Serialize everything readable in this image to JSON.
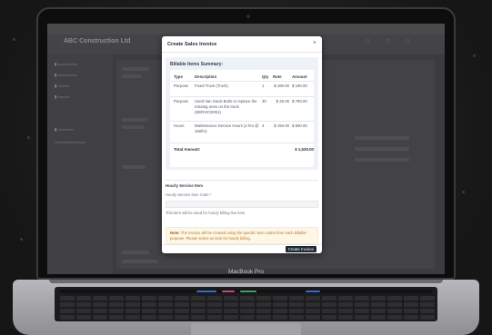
{
  "device": {
    "brand_label": "MacBook Pro"
  },
  "background_app": {
    "company_name": "ABC Construction Ltd"
  },
  "modal": {
    "title": "Create Sales Invoice",
    "close_icon": "close-icon",
    "summary": {
      "title": "Billable Items Summary:",
      "columns": [
        "Type",
        "Description",
        "Qty",
        "Rate",
        "Amount"
      ],
      "rows": [
        {
          "type": "Purpose",
          "description": "Fixed Truck (Truck)",
          "qty": "1",
          "rate": "$ 180.00",
          "amount": "$ 180.00"
        },
        {
          "type": "Purpose",
          "description": "Used Van Stock Bolts to replace the missing ones on the truck (SERVICE001)",
          "qty": "30",
          "rate": "$ 25.00",
          "amount": "$ 750.00"
        },
        {
          "type": "Hours",
          "description": "Maintenance Service Hours (4 hrs @ 150/hr)",
          "qty": "4",
          "rate": "$ 150.00",
          "amount": "$ 600.00"
        }
      ],
      "total_label": "Total Amount:",
      "total_value": "$ 1,530.00"
    },
    "hourly": {
      "title": "Hourly Service Item",
      "field_label": "Hourly Service Item Code *",
      "field_placeholder": "",
      "help_text": "This item will be used for hourly billing line item"
    },
    "note": {
      "label": "Note:",
      "text": "The invoice will be created using the specific item codes from each billable purpose. Please select an item for hourly billing."
    },
    "create_button": "Create Invoice"
  }
}
